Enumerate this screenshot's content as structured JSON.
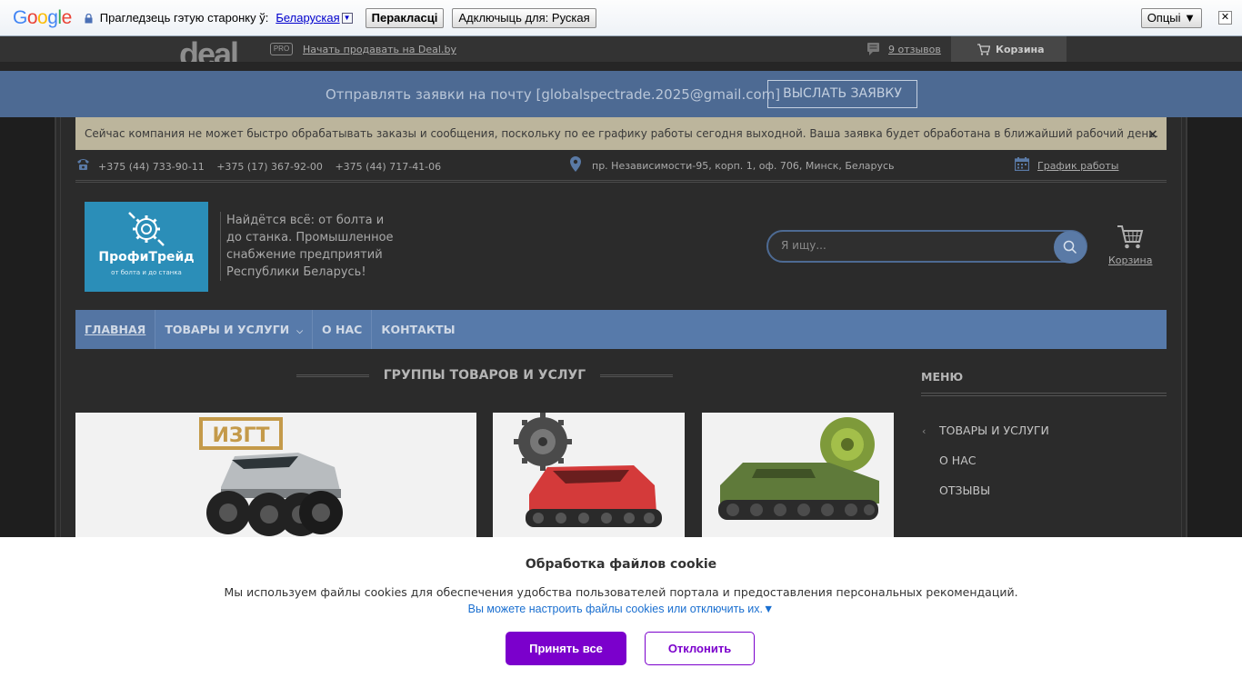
{
  "translate_bar": {
    "logo": "Google",
    "prompt": "Прагледзець гэтую старонку ў:",
    "language": "Беларуская",
    "translate_button": "Перакласці",
    "disable_button": "Адключыць для: Руская",
    "options_button": "Опцыі ▼",
    "close": "✕"
  },
  "deal_bar": {
    "logo": "deal",
    "pro_badge": "PRO",
    "sell_link": "Начать продавать на Deal.by",
    "reviews_link": "9 отзывов",
    "cart_label": "Корзина"
  },
  "request_bar": {
    "text": "Отправлять заявки на почту [globalspectrade.2025@gmail.com]",
    "button": "ВЫСЛАТЬ ЗАЯВКУ"
  },
  "notice": {
    "text": "Сейчас компания не может быстро обрабатывать заказы и сообщения, поскольку по ее графику работы сегодня выходной. Ваша заявка будет обработана в ближайший рабочий день.",
    "close": "×"
  },
  "contacts": {
    "phones": [
      "+375 (44) 733-90-11",
      "+375 (17) 367-92-00",
      "+375 (44) 717-41-06"
    ],
    "address": "пр. Независимости-95, корп. 1, оф. 706, Минск, Беларусь",
    "schedule_link": "График работы"
  },
  "header": {
    "logo_name": "ПрофиТрейд",
    "logo_slogan": "от болта и до станка",
    "tagline": "Найдётся всё: от болта и до станка. Промышленное снабжение предприятий Республики Беларусь!",
    "search_placeholder": "Я ищу...",
    "cart_label": "Корзина"
  },
  "nav": {
    "items": [
      {
        "label": "ГЛАВНАЯ"
      },
      {
        "label": "ТОВАРЫ И УСЛУГИ"
      },
      {
        "label": "О НАС"
      },
      {
        "label": "КОНТАКТЫ"
      }
    ]
  },
  "main": {
    "groups_title": "ГРУППЫ ТОВАРОВ И УСЛУГ",
    "card1_logo_text": "ИЗГТ"
  },
  "sidebar": {
    "title": "МЕНЮ",
    "items": [
      {
        "label": "ТОВАРЫ И УСЛУГИ"
      },
      {
        "label": "О НАС"
      },
      {
        "label": "ОТЗЫВЫ"
      }
    ]
  },
  "cookie": {
    "title": "Обработка файлов cookie",
    "text": "Мы используем файлы cookies для обеспечения удобства пользователей портала и предоставления персональных рекомендаций.",
    "link": "Вы можете настроить файлы cookies или отключить их.▼",
    "accept": "Принять все",
    "decline": "Отклонить"
  },
  "colors": {
    "nav_blue": "#577aaa",
    "request_blue": "#4d6a93",
    "logo_blue": "#2b8eb8",
    "cookie_purple": "#7b00cc"
  }
}
